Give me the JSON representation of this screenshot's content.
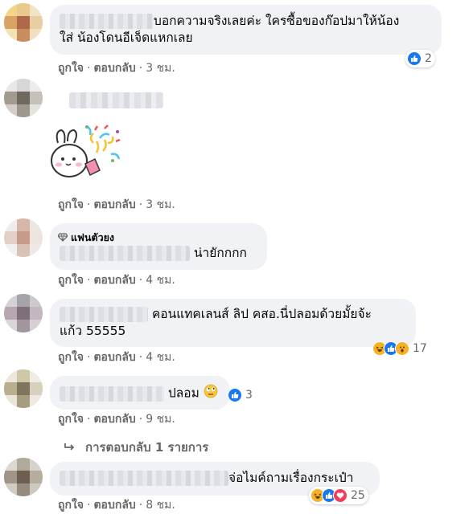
{
  "actions": {
    "like": "ถูกใจ",
    "reply": "ตอบกลับ",
    "sep": "·"
  },
  "comments": [
    {
      "text_line1": "บอกความจริงเลยค่ะ ใครซื้อของก๊อปมาให้น้อง",
      "text_line2": "ใส่ น้องโดนอีเจ็ดแหกเลย",
      "time": "3 ชม.",
      "reactions": {
        "icons": [
          "like-icon"
        ],
        "count": "2"
      }
    },
    {
      "sticker": "confetti-bunny-sticker",
      "time": "3 ชม."
    },
    {
      "badge": "แฟนตัวยง",
      "badge_icon": "diamond-icon",
      "text": "น่ายักกกก",
      "time": "4 ชม."
    },
    {
      "text_line1": "คอนแทคเลนส์ ลิป คสอ.นี่ปลอมด้วยมั้ยจ้ะ",
      "text_line2": "แก้ว 55555",
      "time": "4 ชม.",
      "reactions": {
        "icons": [
          "haha-icon",
          "like-icon",
          "wow-icon"
        ],
        "count": "17"
      }
    },
    {
      "text": "ปลอม",
      "emoji": "rolling-eyes-emoji",
      "time": "9 ชม.",
      "reactions": {
        "icons": [
          "like-icon"
        ],
        "count": "3"
      }
    },
    {
      "text": "จ่อไมค์ถามเรื่องกระเป๋า",
      "time": "8 ชม.",
      "reactions": {
        "icons": [
          "haha-icon",
          "like-icon",
          "love-icon"
        ],
        "count": "25"
      }
    }
  ],
  "replies_link": {
    "label": "การตอบกลับ 1 รายการ",
    "icon": "reply-arrow-icon"
  },
  "colors": {
    "like": "#1877f2",
    "haha": "#f7b125",
    "love": "#f33e58",
    "bubble": "#f0f2f5",
    "meta": "#65676b"
  }
}
